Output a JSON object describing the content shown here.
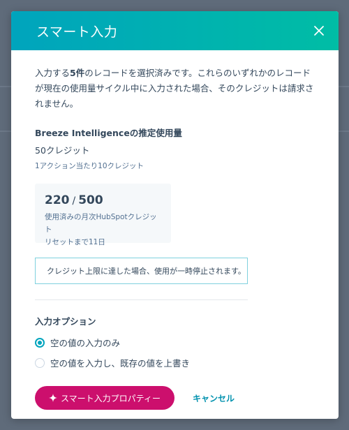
{
  "modal": {
    "title": "スマート入力",
    "close_icon": "close-icon"
  },
  "intro": {
    "prefix": "入力する",
    "count": "5件",
    "suffix": "のレコードを選択済みです。これらのいずれかのレコードが現在の使用量サイクル中に入力された場合、そのクレジットは請求されません。"
  },
  "estimate": {
    "title": "Breeze Intelligenceの推定使用量",
    "value": "50クレジット",
    "rate": "1アクション当たり10クレジット"
  },
  "usage": {
    "used": "220",
    "separator": "/",
    "total": "500",
    "used_fraction": 0.44,
    "label": "使用済みの月次HubSpotクレジット",
    "reset": "リセットまで11日"
  },
  "alert": {
    "text": "クレジット上限に達した場合、使用が一時停止されます。"
  },
  "options": {
    "title": "入力オプション",
    "items": [
      {
        "label": "空の値の入力のみ",
        "checked": true
      },
      {
        "label": "空の値を入力し、既存の値を上書き",
        "checked": false
      }
    ]
  },
  "actions": {
    "primary_label": "スマート入力プロパティー",
    "primary_icon": "sparkle-icon",
    "cancel_label": "キャンセル"
  },
  "colors": {
    "header_start": "#00a4bd",
    "header_end": "#00bda5",
    "primary": "#cc0f6d",
    "link": "#0091ae",
    "radio_accent": "#00a4bd"
  }
}
